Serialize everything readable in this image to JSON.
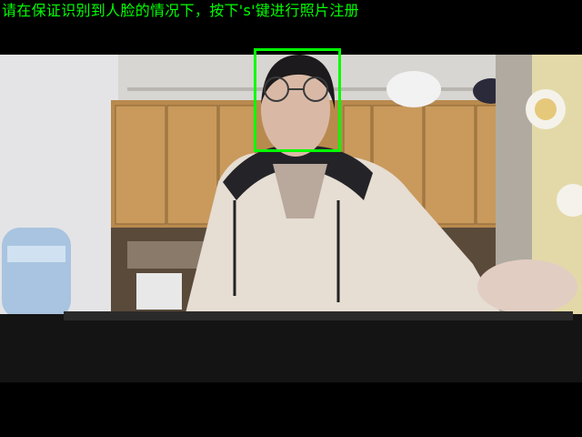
{
  "window": {
    "prompt_text": "请在保证识别到人脸的情况下，按下's'键进行照片注册"
  },
  "colors": {
    "prompt_text": "#00ff00",
    "face_box": "#00ff00",
    "letterbox": "#000000"
  },
  "detection": {
    "faces_detected": 1
  }
}
